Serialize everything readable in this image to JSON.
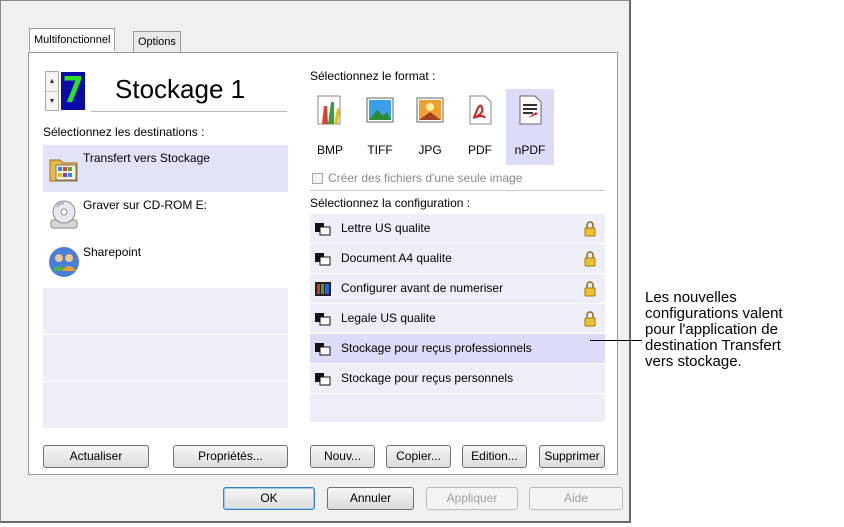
{
  "tabs": [
    "Multifonctionnel",
    "Options"
  ],
  "header": {
    "digit": "7",
    "title": "Stockage 1"
  },
  "destinations": {
    "label": "Sélectionnez les destinations :",
    "items": [
      {
        "label": "Transfert vers Stockage",
        "icon": "storage-folder-icon"
      },
      {
        "label": "Graver sur CD-ROM  E:",
        "icon": "cd-rom-icon"
      },
      {
        "label": "Sharepoint",
        "icon": "sharepoint-people-icon"
      }
    ]
  },
  "format": {
    "label": "Sélectionnez le format :",
    "items": [
      "BMP",
      "TIFF",
      "JPG",
      "PDF",
      "nPDF"
    ],
    "selected": "nPDF",
    "single_image_label": "Créer des fichiers d'une seule image"
  },
  "configuration": {
    "label": "Sélectionnez la configuration :",
    "items": [
      {
        "label": "Lettre US qualite",
        "icon": "scanner-config-icon",
        "locked": true
      },
      {
        "label": "Document A4 qualite",
        "icon": "scanner-config-icon",
        "locked": true
      },
      {
        "label": "Configurer avant de numeriser",
        "icon": "color-config-icon",
        "locked": true
      },
      {
        "label": "Legale US qualite",
        "icon": "scanner-config-icon",
        "locked": true
      },
      {
        "label": "Stockage pour reçus professionnels",
        "icon": "scanner-config-icon",
        "locked": false
      },
      {
        "label": "Stockage pour reçus personnels",
        "icon": "scanner-config-icon",
        "locked": false
      }
    ]
  },
  "buttons": {
    "actualiser": "Actualiser",
    "proprietes": "Propriétés...",
    "nouveau": "Nouv...",
    "copier": "Copier...",
    "edition": "Edition...",
    "supprimer": "Supprimer",
    "ok": "OK",
    "annuler": "Annuler",
    "appliquer": "Appliquer",
    "aide": "Aide"
  },
  "callout": {
    "lines": [
      "Les nouvelles",
      "configurations valent",
      "pour l'application de",
      "destination Transfert",
      "vers stockage."
    ]
  },
  "colors": {
    "selection": "#dcdcf8",
    "list_bg": "#eeeef9",
    "digit_bg": "#0a0aa8",
    "digit_fg": "#28e028"
  }
}
